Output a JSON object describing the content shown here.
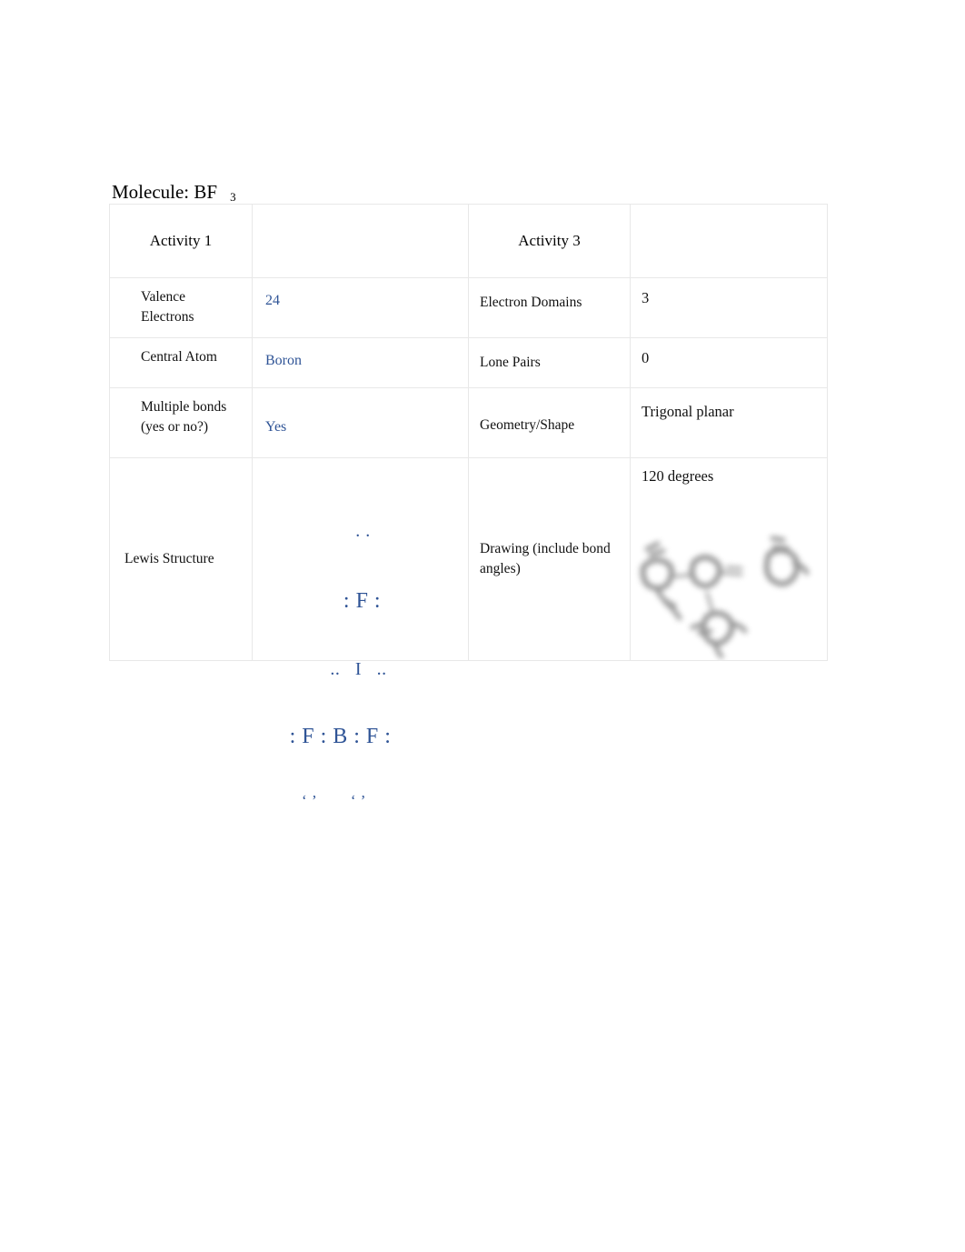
{
  "document": {
    "title_prefix": "Molecule: BF",
    "title_subscript": "3"
  },
  "table": {
    "headers": {
      "activity1": "Activity 1",
      "activity1_blank": "",
      "activity3": "Activity 3",
      "activity3_blank": ""
    },
    "rows": [
      {
        "left_label": "Valence Electrons",
        "left_value": "24",
        "right_label": "Electron Domains",
        "right_value": "3"
      },
      {
        "left_label": "Central Atom",
        "left_value": "Boron",
        "right_label": "Lone Pairs",
        "right_value": "0"
      },
      {
        "left_label": "Multiple bonds (yes or no?)",
        "left_value": "Yes",
        "right_label": "Geometry/Shape",
        "right_value": "Trigonal planar"
      }
    ],
    "structure_row": {
      "left_label": "Lewis Structure",
      "right_label": "Drawing (include bond angles)",
      "bond_angle": "120 degrees"
    }
  },
  "lewis_structure": {
    "line1": ". .",
    "line2": ": F :",
    "line3": "..   I   ..",
    "line4": ": F : B : F :",
    "line5": "‘ ’        ‘ ’",
    "color": "#2f5496"
  },
  "colors": {
    "answer_blue": "#2f5496",
    "answer_black": "#111111",
    "border": "#e8e8e8",
    "page_background": "#ffffff"
  }
}
